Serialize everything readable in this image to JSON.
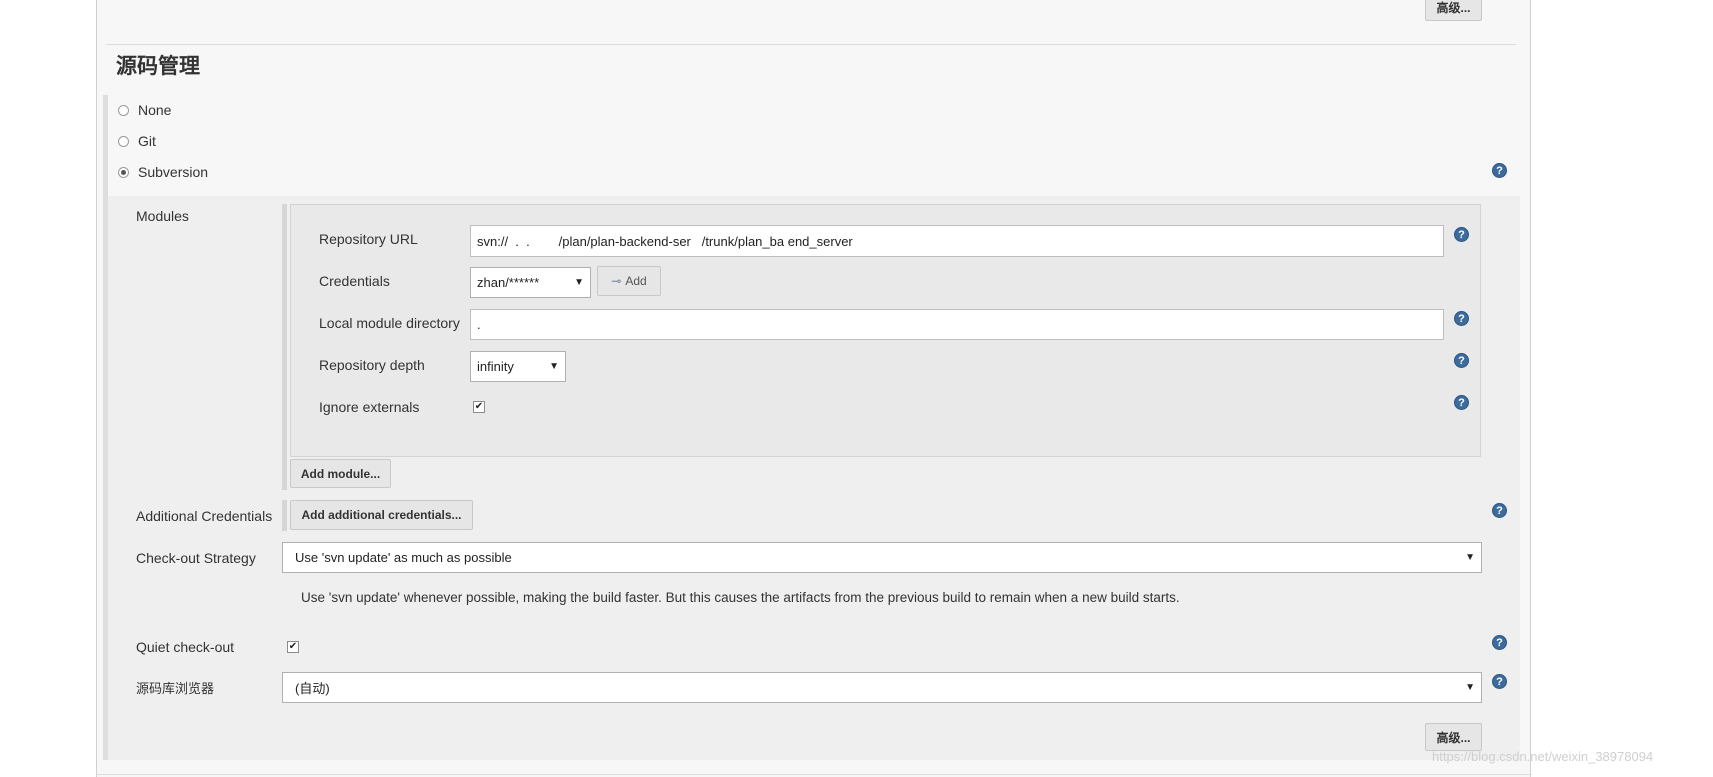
{
  "top": {
    "advanced_label": "高级..."
  },
  "section": {
    "title": "源码管理"
  },
  "scm_options": [
    {
      "label": "None",
      "selected": false
    },
    {
      "label": "Git",
      "selected": false
    },
    {
      "label": "Subversion",
      "selected": true
    }
  ],
  "modules": {
    "label": "Modules",
    "repository_url": {
      "label": "Repository URL",
      "value": "svn://  .  .        /plan/plan-backend-ser   /trunk/plan_ba end_server"
    },
    "credentials": {
      "label": "Credentials",
      "value": "zhan/******",
      "add_label": "Add"
    },
    "local_dir": {
      "label": "Local module directory",
      "value": "."
    },
    "depth": {
      "label": "Repository depth",
      "value": "infinity"
    },
    "ignore_externals": {
      "label": "Ignore externals",
      "checked": true
    },
    "add_module_label": "Add module..."
  },
  "additional_credentials": {
    "label": "Additional Credentials",
    "button_label": "Add additional credentials..."
  },
  "checkout_strategy": {
    "label": "Check-out Strategy",
    "value": "Use 'svn update' as much as possible",
    "description": "Use 'svn update' whenever possible, making the build faster. But this causes the artifacts from the previous build to remain when a new build starts."
  },
  "quiet_checkout": {
    "label": "Quiet check-out",
    "checked": true
  },
  "repo_browser": {
    "label": "源码库浏览器",
    "value": "(自动)"
  },
  "bottom": {
    "advanced_label": "高级..."
  },
  "help_glyph": "?",
  "check_glyph": "✔",
  "watermark": "https://blog.csdn.net/weixin_38978094",
  "colors": {
    "help": "#3d6c9c",
    "panel": "#f7f7f7",
    "block": "#efefef"
  }
}
